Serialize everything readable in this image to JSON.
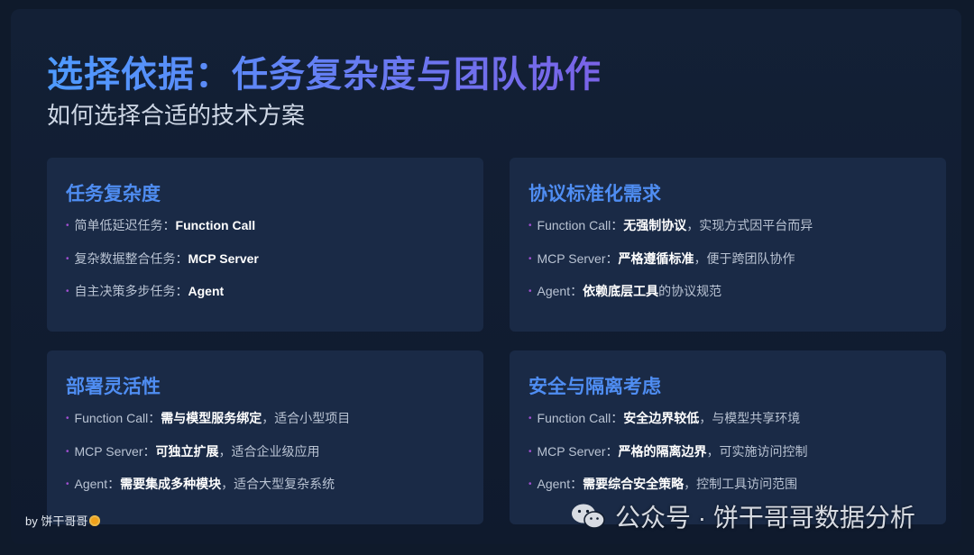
{
  "header": {
    "title": "选择依据：任务复杂度与团队协作",
    "subtitle": "如何选择合适的技术方案"
  },
  "cards": [
    {
      "title": "任务复杂度",
      "items": [
        {
          "prefix": "简单低延迟任务：",
          "strong": "Function Call",
          "suffix": ""
        },
        {
          "prefix": "复杂数据整合任务：",
          "strong": "MCP Server",
          "suffix": ""
        },
        {
          "prefix": "自主决策多步任务：",
          "strong": "Agent",
          "suffix": ""
        }
      ]
    },
    {
      "title": "协议标准化需求",
      "items": [
        {
          "prefix": "Function Call：",
          "strong": "无强制协议",
          "suffix": "，实现方式因平台而异"
        },
        {
          "prefix": "MCP Server：",
          "strong": "严格遵循标准",
          "suffix": "，便于跨团队协作"
        },
        {
          "prefix": "Agent：",
          "strong": "依赖底层工具",
          "suffix": "的协议规范"
        }
      ]
    },
    {
      "title": "部署灵活性",
      "items": [
        {
          "prefix": "Function Call：",
          "strong": "需与模型服务绑定",
          "suffix": "，适合小型项目"
        },
        {
          "prefix": "MCP Server：",
          "strong": "可独立扩展",
          "suffix": "，适合企业级应用"
        },
        {
          "prefix": "Agent：",
          "strong": "需要集成多种模块",
          "suffix": "，适合大型复杂系统"
        }
      ]
    },
    {
      "title": "安全与隔离考虑",
      "items": [
        {
          "prefix": "Function Call：",
          "strong": "安全边界较低",
          "suffix": "，与模型共享环境"
        },
        {
          "prefix": "MCP Server：",
          "strong": "严格的隔离边界",
          "suffix": "，可实施访问控制"
        },
        {
          "prefix": "Agent：",
          "strong": "需要综合安全策略",
          "suffix": "，控制工具访问范围"
        }
      ]
    }
  ],
  "bullet_glyph": "•",
  "footer": {
    "credit": "by 饼干哥哥",
    "coin_icon": "cookie-icon"
  },
  "watermark": {
    "text": "公众号 · 饼干哥哥数据分析",
    "icon": "wechat-icon"
  },
  "colors": {
    "background": "#0f1a2b",
    "card": "#1a2a46",
    "title_gradient_start": "#4e9bff",
    "title_gradient_end": "#7a63e8",
    "card_title": "#4f8df2",
    "bullet": "#a04fd0",
    "body_text": "#b9c3d3"
  }
}
